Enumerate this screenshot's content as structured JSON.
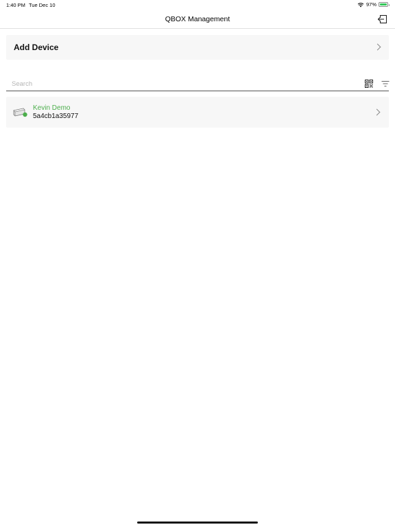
{
  "status_bar": {
    "time": "1:40 PM",
    "date": "Tue Dec 10",
    "battery": "97%",
    "icons": [
      "wifi-icon",
      "battery-icon"
    ]
  },
  "nav": {
    "title": "QBOX Management",
    "logout_icon": "logout-icon"
  },
  "add_device": {
    "label": "Add Device"
  },
  "search": {
    "placeholder": "Search",
    "value": "",
    "qr_icon": "qr-code-icon",
    "filter_icon": "filter-icon"
  },
  "devices": [
    {
      "name": "Kevin Demo",
      "id": "5a4cb1a35977",
      "status_color": "#4cae4c"
    }
  ]
}
